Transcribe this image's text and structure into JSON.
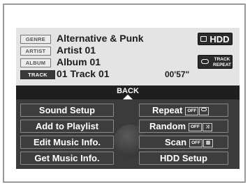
{
  "track_info": {
    "genre_tag": "GENRE",
    "genre": "Alternative & Punk",
    "artist_tag": "ARTIST",
    "artist": "Artist 01",
    "album_tag": "ALBUM",
    "album": "Album 01",
    "track_tag": "TRACK",
    "track": "01 Track 01",
    "time": "00'57\""
  },
  "source_button": {
    "label": "HDD"
  },
  "track_repeat_button": {
    "line1": "TRACK",
    "line2": "REPEAT"
  },
  "back_button": {
    "label": "BACK"
  },
  "menu": {
    "left": [
      "Sound Setup",
      "Add to Playlist",
      "Edit Music Info.",
      "Get Music Info."
    ],
    "repeat": {
      "label": "Repeat",
      "state": "OFF"
    },
    "random": {
      "label": "Random",
      "state": "OFF"
    },
    "scan": {
      "label": "Scan",
      "state": "OFF"
    },
    "hdd_setup": "HDD Setup"
  }
}
